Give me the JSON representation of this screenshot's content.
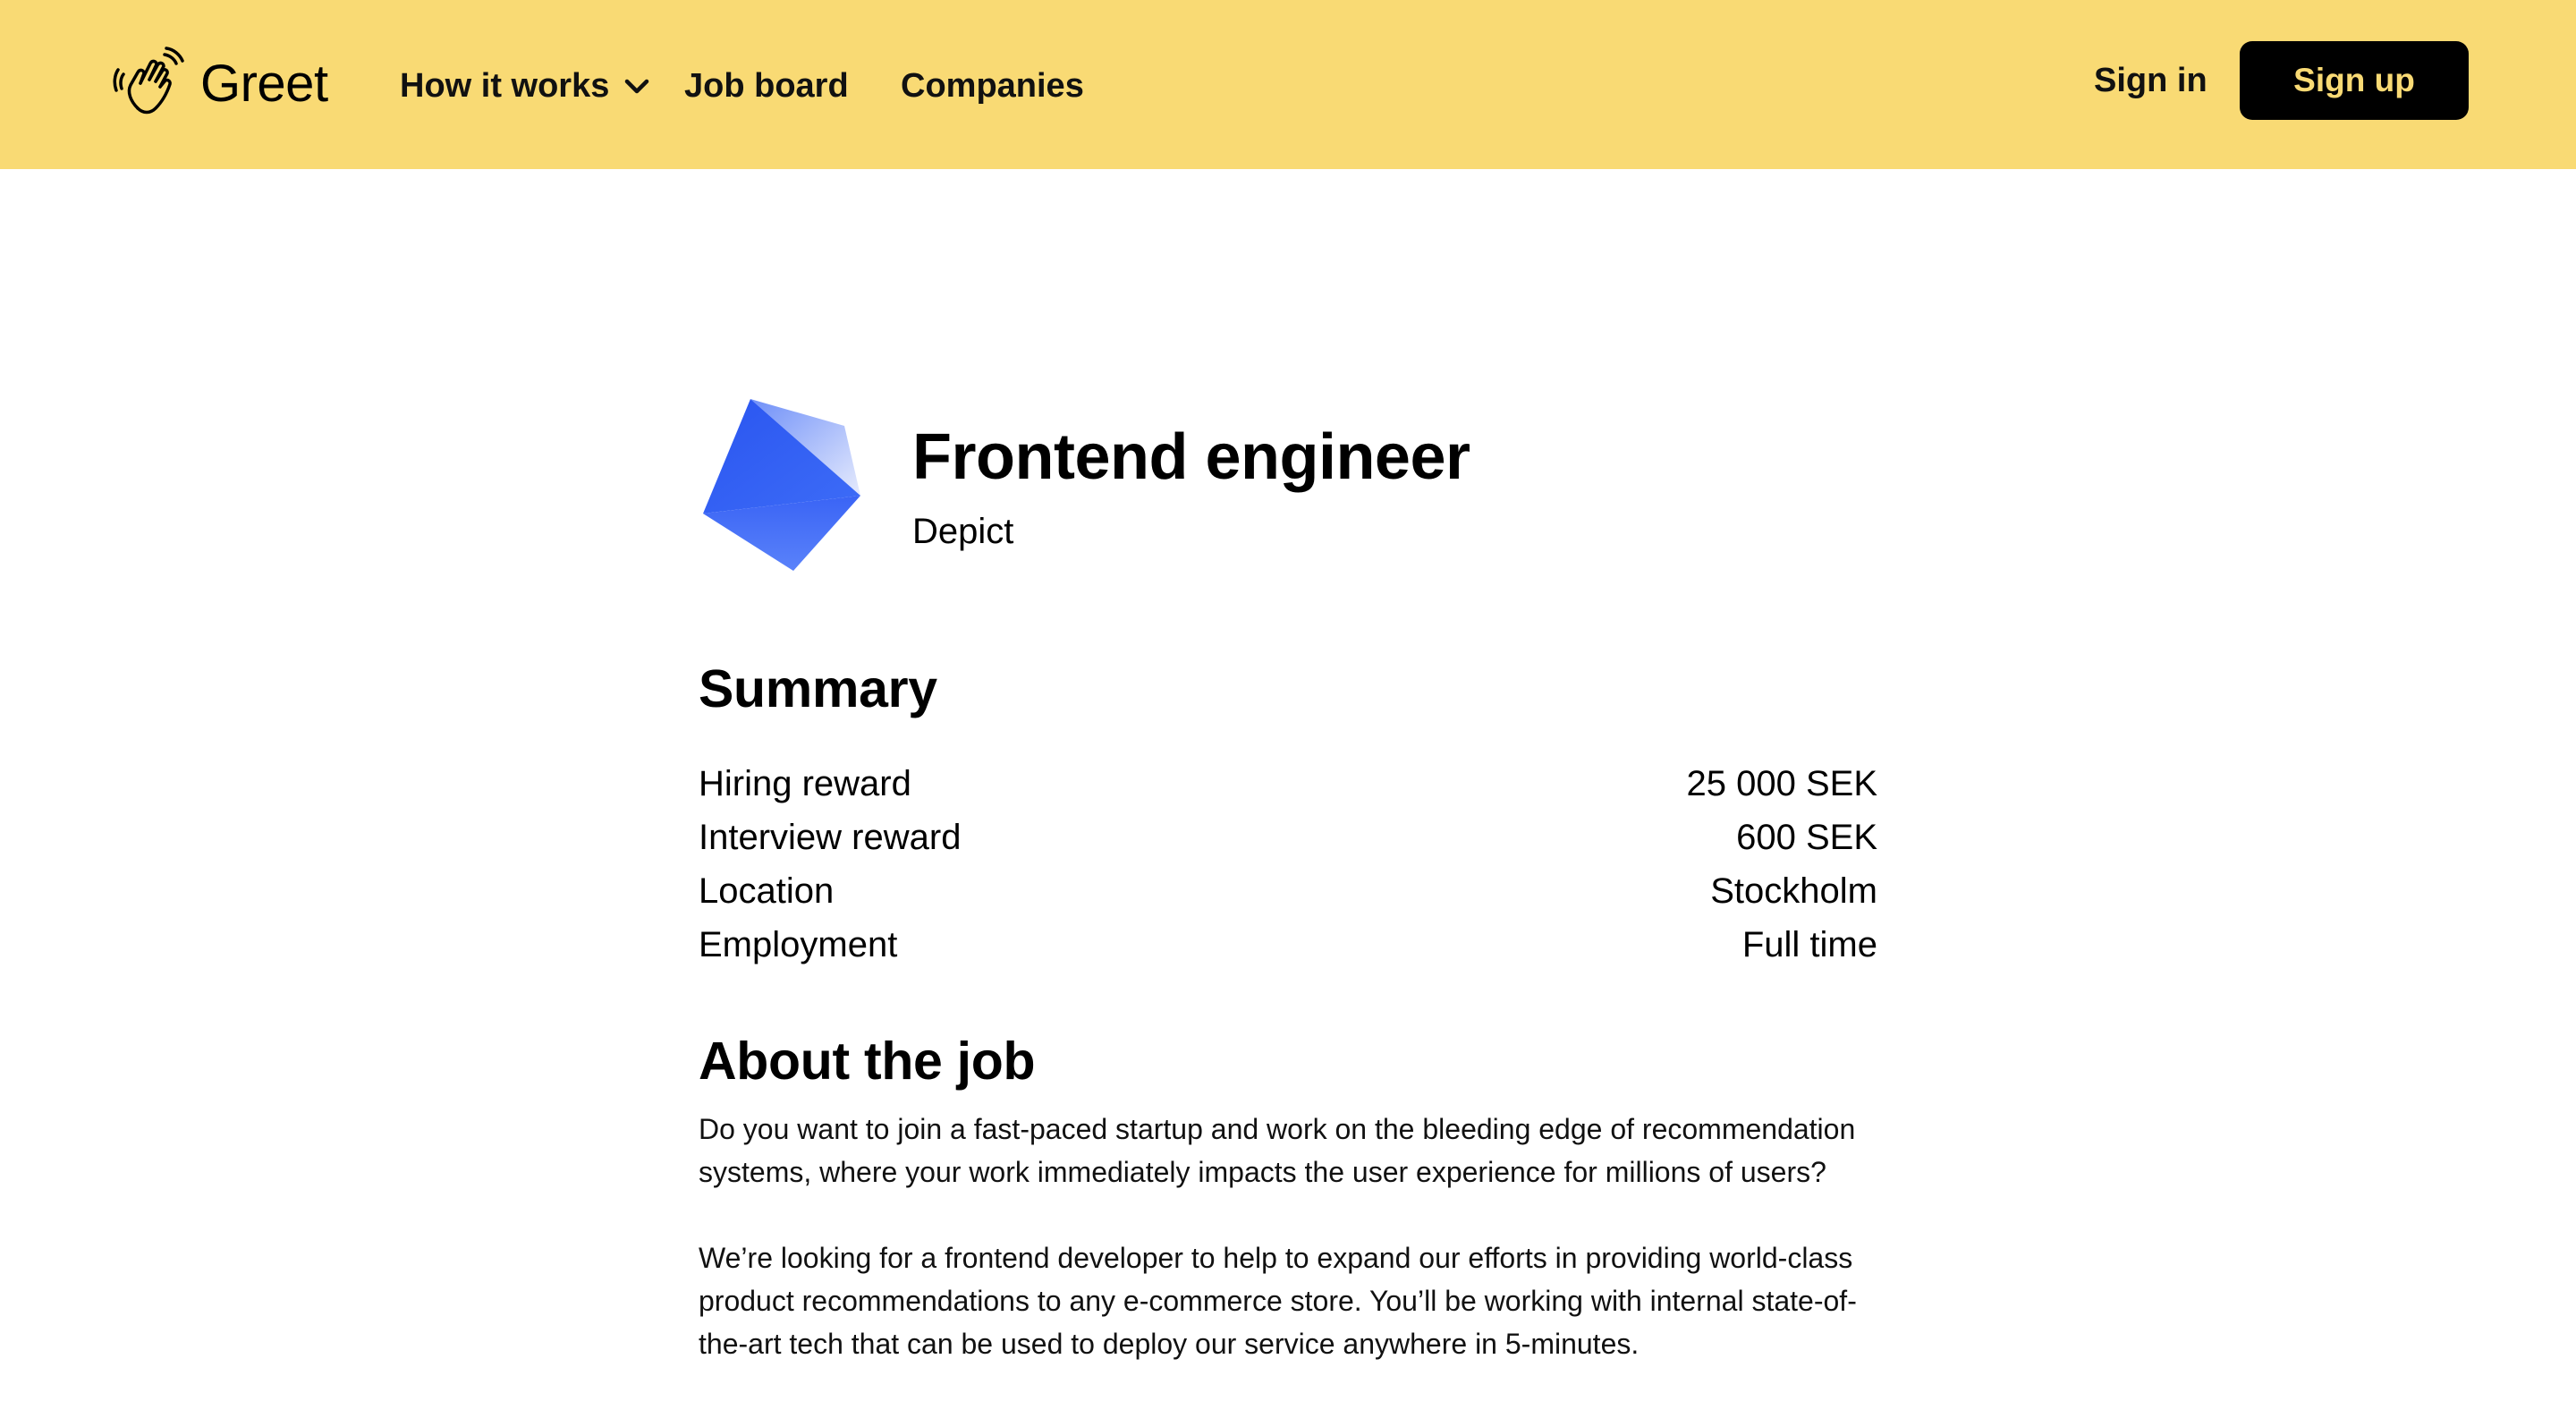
{
  "header": {
    "brand": "Greet",
    "nav": {
      "how_it_works": "How it works",
      "job_board": "Job board",
      "companies": "Companies"
    },
    "sign_in": "Sign in",
    "sign_up": "Sign up",
    "colors": {
      "background": "#f9da74",
      "signup_bg": "#000000",
      "signup_text": "#f9da74"
    },
    "icons": {
      "logo": "waving-hand-icon",
      "dropdown": "chevron-down-icon"
    }
  },
  "job": {
    "title": "Frontend engineer",
    "company": "Depict",
    "company_logo_icon": "blue-pentagon-logo",
    "company_logo_color": "#2b5cf5"
  },
  "summary": {
    "heading": "Summary",
    "rows": [
      {
        "label": "Hiring reward",
        "value": "25 000 SEK"
      },
      {
        "label": "Interview reward",
        "value": "600 SEK"
      },
      {
        "label": "Location",
        "value": "Stockholm"
      },
      {
        "label": "Employment",
        "value": "Full time"
      }
    ]
  },
  "about": {
    "heading": "About the job",
    "paragraphs": [
      "Do you want to join a fast-paced startup and work on the bleeding edge of recommendation systems, where your work immediately impacts the user experience for millions of users?",
      "We’re looking for a frontend developer to help to expand our efforts in providing world-class product recommendations to any e-commerce store. You’ll be working with internal state-of-the-art tech that can be used to deploy our service anywhere in 5-minutes."
    ]
  }
}
